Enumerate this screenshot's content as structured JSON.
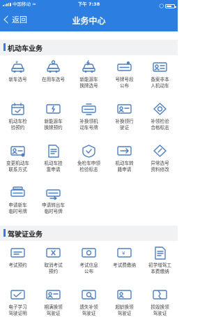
{
  "status_bar": {
    "carrier": "中国移动",
    "time": "下午 7:38",
    "battery_level": 0.6
  },
  "nav": {
    "back_label": "返回",
    "title": "业务中心"
  },
  "colors": {
    "primary": "#2c7fe0",
    "icon": "#4f7fbf"
  },
  "sections": [
    {
      "title": "机动车业务",
      "items": [
        {
          "label": "新车选号",
          "icon": "car-number-icon"
        },
        {
          "label": "在用车选号",
          "icon": "used-car-icon"
        },
        {
          "label": "新能源车\n换牌选号",
          "icon": "ev-car-icon"
        },
        {
          "label": "号牌号段\n公布",
          "icon": "plate-notice-icon"
        },
        {
          "label": "备案非本\n人机动车",
          "icon": "car-person-icon"
        },
        {
          "label": "机动车检\n验预约",
          "icon": "inspection-calendar-icon"
        },
        {
          "label": "新能源车\n换牌预约",
          "icon": "ev-appointment-icon"
        },
        {
          "label": "补换领机\n动车号牌",
          "icon": "plate-replace-icon"
        },
        {
          "label": "补换领行\n驶证",
          "icon": "license-card-icon"
        },
        {
          "label": "补领检验\n合格标志",
          "icon": "certificate-icon"
        },
        {
          "label": "变更机动车\n联系方式",
          "icon": "contact-card-icon"
        },
        {
          "label": "机动车挂\n靠申请",
          "icon": "document-plate-icon"
        },
        {
          "label": "免检车申领\n检验标志",
          "icon": "exempt-badge-icon"
        },
        {
          "label": "机动车转\n籍申请",
          "icon": "transfer-card-icon"
        },
        {
          "label": "异常选号\n资料修改",
          "icon": "edit-document-icon"
        },
        {
          "label": "申请新车\n临时号牌",
          "icon": "temp-plate-icon"
        },
        {
          "label": "申请转出车\n临时号牌",
          "icon": "transfer-plate-icon"
        }
      ]
    },
    {
      "title": "驾驶证业务",
      "items": [
        {
          "label": "考试预约",
          "icon": "exam-booking-icon"
        },
        {
          "label": "取消考试\n预约",
          "icon": "cancel-booking-icon"
        },
        {
          "label": "考试信息\n公布",
          "icon": "exam-info-icon"
        },
        {
          "label": "考试费缴纳",
          "icon": "exam-fee-icon"
        },
        {
          "label": "初学增驾工\n本费缴纳",
          "icon": "fee-document-icon"
        },
        {
          "label": "电子学习\n驾驶证明",
          "icon": "e-certificate-icon"
        },
        {
          "label": "期满换领\n驾驶证",
          "icon": "renew-license-icon"
        },
        {
          "label": "遗失补领\n驾驶证",
          "icon": "lost-license-icon"
        },
        {
          "label": "超龄换领\n驾驶证",
          "icon": "aged-license-icon"
        },
        {
          "label": "损毁换领\n驾驶证",
          "icon": "damaged-license-icon"
        }
      ]
    }
  ]
}
